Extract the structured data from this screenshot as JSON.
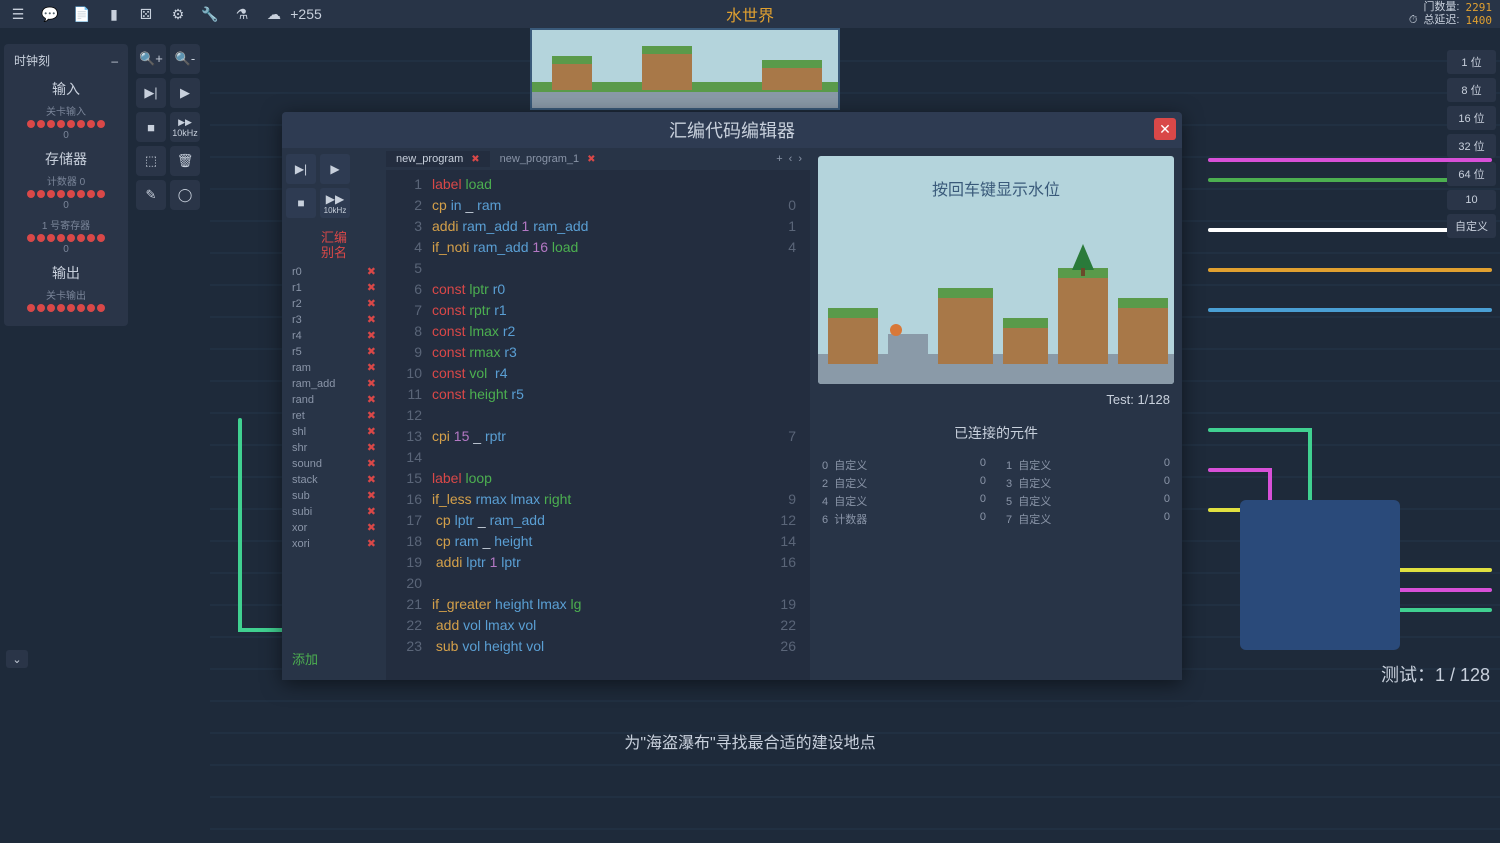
{
  "topbar": {
    "title": "水世界",
    "plus_count": "+255",
    "stats": {
      "gates_label": "门数量:",
      "gates_val": "2291",
      "delay_label": "总延迟:",
      "delay_val": "1400"
    }
  },
  "left_panel": {
    "clock_label": "时钟刻",
    "sections": [
      {
        "title": "输入",
        "sub": "关卡输入",
        "val": "0"
      },
      {
        "title": "存储器",
        "sub": "计数器 0",
        "val": "0",
        "sub2": "1 号寄存器",
        "val2": "0"
      },
      {
        "title": "输出",
        "sub": "关卡输出",
        "val": ""
      }
    ]
  },
  "toolbar": {
    "khz": "10kHz"
  },
  "right_pills": [
    "1 位",
    "8 位",
    "16 位",
    "32 位",
    "64 位",
    "10",
    "自定义"
  ],
  "modal": {
    "title": "汇编代码编辑器",
    "alias_header": "汇编\n别名",
    "aliases": [
      "r0",
      "r1",
      "r2",
      "r3",
      "r4",
      "r5",
      "ram",
      "ram_add",
      "rand",
      "ret",
      "shl",
      "shr",
      "sound",
      "stack",
      "sub",
      "subi",
      "xor",
      "xori"
    ],
    "add_label": "添加",
    "tabs": [
      {
        "name": "new_program",
        "active": true
      },
      {
        "name": "new_program_1",
        "active": false
      }
    ],
    "code": [
      {
        "n": 1,
        "out": "",
        "html": "<span class='tk-r'>label</span> <span class='tk-g'>load</span>"
      },
      {
        "n": 2,
        "out": "0",
        "html": "<span class='tk-y'>cp</span> <span class='tk-b'>in</span> <span class='tk-w'>_</span> <span class='tk-b'>ram</span>"
      },
      {
        "n": 3,
        "out": "1",
        "html": "<span class='tk-y'>addi</span> <span class='tk-b'>ram_add</span> <span class='tk-p'>1</span> <span class='tk-b'>ram_add</span>"
      },
      {
        "n": 4,
        "out": "4",
        "html": "<span class='tk-y'>if_noti</span> <span class='tk-b'>ram_add</span> <span class='tk-p'>16</span> <span class='tk-g'>load</span>"
      },
      {
        "n": 5,
        "out": "",
        "html": ""
      },
      {
        "n": 6,
        "out": "",
        "html": "<span class='tk-r'>const</span> <span class='tk-g'>lptr</span> <span class='tk-b'>r0</span>"
      },
      {
        "n": 7,
        "out": "",
        "html": "<span class='tk-r'>const</span> <span class='tk-g'>rptr</span> <span class='tk-b'>r1</span>"
      },
      {
        "n": 8,
        "out": "",
        "html": "<span class='tk-r'>const</span> <span class='tk-g'>lmax</span> <span class='tk-b'>r2</span>"
      },
      {
        "n": 9,
        "out": "",
        "html": "<span class='tk-r'>const</span> <span class='tk-g'>rmax</span> <span class='tk-b'>r3</span>"
      },
      {
        "n": 10,
        "out": "",
        "html": "<span class='tk-r'>const</span> <span class='tk-g'>vol</span>  <span class='tk-b'>r4</span>"
      },
      {
        "n": 11,
        "out": "",
        "html": "<span class='tk-r'>const</span> <span class='tk-g'>height</span> <span class='tk-b'>r5</span>"
      },
      {
        "n": 12,
        "out": "",
        "html": ""
      },
      {
        "n": 13,
        "out": "7",
        "html": "<span class='tk-y'>cpi</span> <span class='tk-p'>15</span> <span class='tk-w'>_</span> <span class='tk-b'>rptr</span>"
      },
      {
        "n": 14,
        "out": "",
        "html": ""
      },
      {
        "n": 15,
        "out": "",
        "html": "<span class='tk-r'>label</span> <span class='tk-g'>loop</span>"
      },
      {
        "n": 16,
        "out": "9",
        "html": "<span class='tk-y'>if_less</span> <span class='tk-b'>rmax</span> <span class='tk-b'>lmax</span> <span class='tk-g'>right</span>"
      },
      {
        "n": 17,
        "out": "12",
        "html": " <span class='tk-y'>cp</span> <span class='tk-b'>lptr</span> <span class='tk-w'>_</span> <span class='tk-b'>ram_add</span>"
      },
      {
        "n": 18,
        "out": "14",
        "html": " <span class='tk-y'>cp</span> <span class='tk-b'>ram</span> <span class='tk-w'>_</span> <span class='tk-b'>height</span>"
      },
      {
        "n": 19,
        "out": "16",
        "html": " <span class='tk-y'>addi</span> <span class='tk-b'>lptr</span> <span class='tk-p'>1</span> <span class='tk-b'>lptr</span>"
      },
      {
        "n": 20,
        "out": "",
        "html": ""
      },
      {
        "n": 21,
        "out": "19",
        "html": "<span class='tk-y'>if_greater</span> <span class='tk-b'>height</span> <span class='tk-b'>lmax</span> <span class='tk-g'>lg</span>"
      },
      {
        "n": 22,
        "out": "22",
        "html": " <span class='tk-y'>add</span> <span class='tk-b'>vol</span> <span class='tk-b'>lmax</span> <span class='tk-b'>vol</span>"
      },
      {
        "n": 23,
        "out": "26",
        "html": " <span class='tk-y'>sub</span> <span class='tk-b'>vol</span> <span class='tk-b'>height</span> <span class='tk-b'>vol</span>"
      }
    ],
    "preview_text": "按回车键显示水位",
    "test_label": "Test: 1/128",
    "conn_title": "已连接的元件",
    "connections": [
      {
        "n": "0",
        "name": "自定义",
        "v": "0"
      },
      {
        "n": "1",
        "name": "自定义",
        "v": "0"
      },
      {
        "n": "2",
        "name": "自定义",
        "v": "0"
      },
      {
        "n": "3",
        "name": "自定义",
        "v": "0"
      },
      {
        "n": "4",
        "name": "自定义",
        "v": "0"
      },
      {
        "n": "5",
        "name": "自定义",
        "v": "0"
      },
      {
        "n": "6",
        "name": "计数器",
        "v": "0"
      },
      {
        "n": "7",
        "name": "自定义",
        "v": "0"
      }
    ]
  },
  "footer": {
    "hint": "为\"海盗瀑布\"寻找最合适的建设地点",
    "test": "测试：1 / 128"
  }
}
